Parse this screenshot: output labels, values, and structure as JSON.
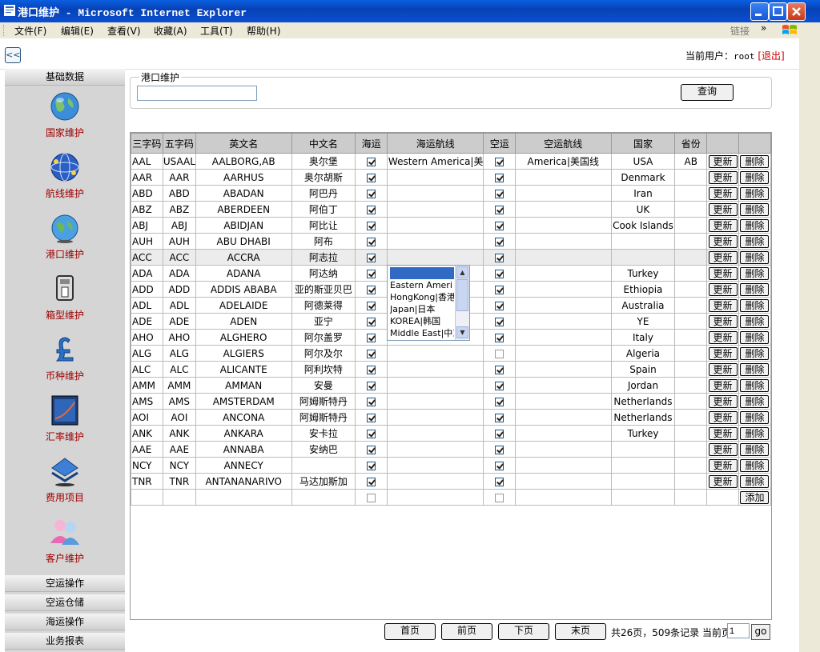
{
  "window": {
    "title": "港口维护 - Microsoft Internet Explorer"
  },
  "menu": {
    "items": [
      "文件(F)",
      "编辑(E)",
      "查看(V)",
      "收藏(A)",
      "工具(T)",
      "帮助(H)"
    ],
    "links_label": "链接",
    "chevron": "»"
  },
  "topbar": {
    "user_label": "当前用户：",
    "user_name": "root",
    "logout": "[退出]",
    "collapse_glyph": "<<"
  },
  "sidebar": {
    "section_main": "基础数据",
    "items": [
      {
        "label": "国家维护",
        "icon": "globe-icon"
      },
      {
        "label": "航线维护",
        "icon": "network-globe-icon"
      },
      {
        "label": "港口维护",
        "icon": "globe-icon"
      },
      {
        "label": "箱型维护",
        "icon": "container-icon"
      },
      {
        "label": "币种维护",
        "icon": "pound-currency-icon"
      },
      {
        "label": "汇率维护",
        "icon": "chart-icon"
      },
      {
        "label": "费用项目",
        "icon": "layers-icon"
      },
      {
        "label": "客户维护",
        "icon": "users-icon"
      }
    ],
    "bottom_sections": [
      "空运操作",
      "空运仓储",
      "海运操作",
      "业务报表"
    ]
  },
  "search": {
    "legend": "港口维护",
    "value": "",
    "button": "查询"
  },
  "table": {
    "headers": [
      "三字码",
      "五字码",
      "英文名",
      "中文名",
      "海运",
      "海运航线",
      "空运",
      "空运航线",
      "国家",
      "省份",
      "",
      ""
    ],
    "update_label": "更新",
    "delete_label": "删除",
    "add_label": "添加",
    "rows": [
      {
        "code3": "AAL",
        "code5": "USAAL",
        "en": "AALBORG,AB",
        "cn": "奥尔堡",
        "sea": true,
        "sea_route": "Western America|美",
        "air": true,
        "air_route": "America|美国线",
        "country": "USA",
        "province": "AB"
      },
      {
        "code3": "AAR",
        "code5": "AAR",
        "en": "AARHUS",
        "cn": "奥尔胡斯",
        "sea": true,
        "sea_route": "",
        "air": true,
        "air_route": "",
        "country": "Denmark",
        "province": ""
      },
      {
        "code3": "ABD",
        "code5": "ABD",
        "en": "ABADAN",
        "cn": "阿巴丹",
        "sea": true,
        "sea_route": "",
        "air": true,
        "air_route": "",
        "country": "Iran",
        "province": ""
      },
      {
        "code3": "ABZ",
        "code5": "ABZ",
        "en": "ABERDEEN",
        "cn": "阿伯丁",
        "sea": true,
        "sea_route": "",
        "air": true,
        "air_route": "",
        "country": "UK",
        "province": ""
      },
      {
        "code3": "ABJ",
        "code5": "ABJ",
        "en": "ABIDJAN",
        "cn": "阿比让",
        "sea": true,
        "sea_route": "",
        "air": true,
        "air_route": "",
        "country": "Cook Islands",
        "province": ""
      },
      {
        "code3": "AUH",
        "code5": "AUH",
        "en": "ABU DHABI",
        "cn": "阿布",
        "sea": true,
        "sea_route": "",
        "air": true,
        "air_route": "",
        "country": "",
        "province": ""
      },
      {
        "code3": "ACC",
        "code5": "ACC",
        "en": "ACCRA",
        "cn": "阿志拉",
        "sea": true,
        "sea_route": "",
        "air": true,
        "air_route": "",
        "country": "",
        "province": ""
      },
      {
        "code3": "ADA",
        "code5": "ADA",
        "en": "ADANA",
        "cn": "阿达纳",
        "sea": true,
        "sea_route": "",
        "air": true,
        "air_route": "",
        "country": "Turkey",
        "province": ""
      },
      {
        "code3": "ADD",
        "code5": "ADD",
        "en": "ADDIS ABABA",
        "cn": "亚的斯亚贝巴",
        "sea": true,
        "sea_route": "",
        "air": true,
        "air_route": "",
        "country": "Ethiopia",
        "province": ""
      },
      {
        "code3": "ADL",
        "code5": "ADL",
        "en": "ADELAIDE",
        "cn": "阿德莱得",
        "sea": true,
        "sea_route": "",
        "air": true,
        "air_route": "",
        "country": "Australia",
        "province": ""
      },
      {
        "code3": "ADE",
        "code5": "ADE",
        "en": "ADEN",
        "cn": "亚宁",
        "sea": true,
        "sea_route": "",
        "air": true,
        "air_route": "",
        "country": "YE",
        "province": ""
      },
      {
        "code3": "AHO",
        "code5": "AHO",
        "en": "ALGHERO",
        "cn": "阿尔盖罗",
        "sea": true,
        "sea_route": "",
        "air": true,
        "air_route": "",
        "country": "Italy",
        "province": ""
      },
      {
        "code3": "ALG",
        "code5": "ALG",
        "en": "ALGIERS",
        "cn": "阿尔及尔",
        "sea": true,
        "sea_route": "",
        "air": false,
        "air_route": "",
        "country": "Algeria",
        "province": ""
      },
      {
        "code3": "ALC",
        "code5": "ALC",
        "en": "ALICANTE",
        "cn": "阿利坎特",
        "sea": true,
        "sea_route": "",
        "air": true,
        "air_route": "",
        "country": "Spain",
        "province": ""
      },
      {
        "code3": "AMM",
        "code5": "AMM",
        "en": "AMMAN",
        "cn": "安曼",
        "sea": true,
        "sea_route": "",
        "air": true,
        "air_route": "",
        "country": "Jordan",
        "province": ""
      },
      {
        "code3": "AMS",
        "code5": "AMS",
        "en": "AMSTERDAM",
        "cn": "阿姆斯特丹",
        "sea": true,
        "sea_route": "",
        "air": true,
        "air_route": "",
        "country": "Netherlands",
        "province": ""
      },
      {
        "code3": "AOI",
        "code5": "AOI",
        "en": "ANCONA",
        "cn": "阿姆斯特丹",
        "sea": true,
        "sea_route": "",
        "air": true,
        "air_route": "",
        "country": "Netherlands",
        "province": ""
      },
      {
        "code3": "ANK",
        "code5": "ANK",
        "en": "ANKARA",
        "cn": "安卡拉",
        "sea": true,
        "sea_route": "",
        "air": true,
        "air_route": "",
        "country": "Turkey",
        "province": ""
      },
      {
        "code3": "AAE",
        "code5": "AAE",
        "en": "ANNABA",
        "cn": "安纳巴",
        "sea": true,
        "sea_route": "",
        "air": true,
        "air_route": "",
        "country": "",
        "province": ""
      },
      {
        "code3": "NCY",
        "code5": "NCY",
        "en": "ANNECY",
        "cn": "",
        "sea": true,
        "sea_route": "",
        "air": true,
        "air_route": "",
        "country": "",
        "province": ""
      },
      {
        "code3": "TNR",
        "code5": "TNR",
        "en": "ANTANANARIVO",
        "cn": "马达加斯加",
        "sea": true,
        "sea_route": "",
        "air": true,
        "air_route": "",
        "country": "",
        "province": ""
      }
    ],
    "route_options": [
      "Eastern Ameri",
      "HongKong|香港",
      "Japan|日本",
      "KOREA|韩国",
      "Middle East|中东"
    ]
  },
  "pagination": {
    "first": "首页",
    "prev": "前页",
    "next": "下页",
    "last": "末页",
    "summary": "共26页，509条记录 当前页",
    "current_page": "1",
    "go": "go"
  },
  "colors": {
    "title_bar": "#0842b6",
    "sidebar_label": "#a00000",
    "logout": "#cc0000",
    "header_bg": "#cccccc"
  }
}
